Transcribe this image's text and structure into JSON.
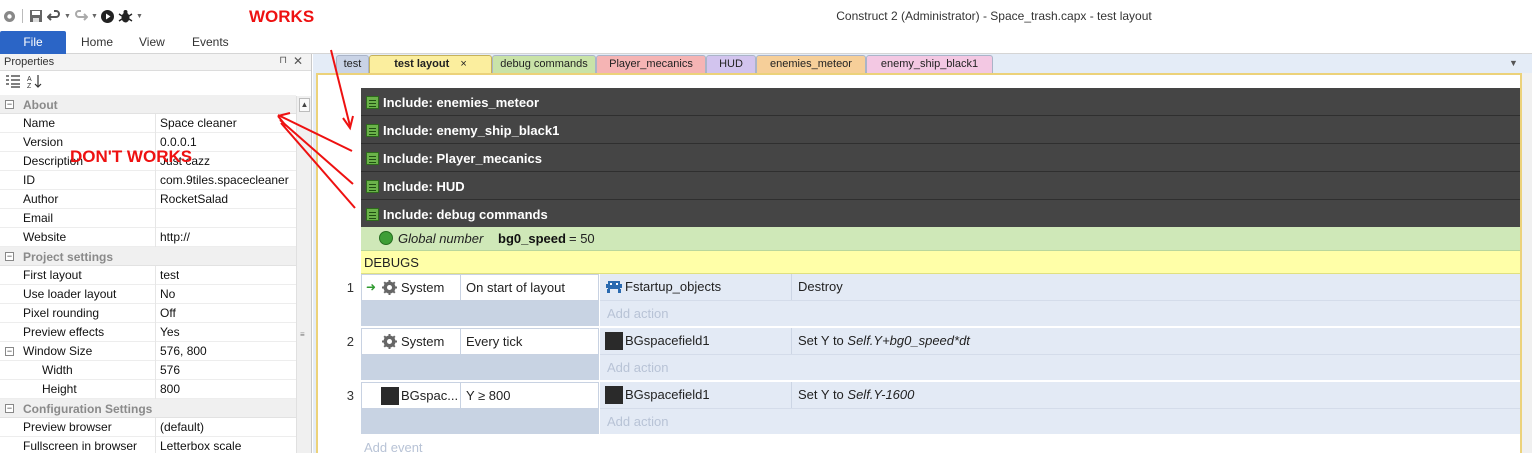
{
  "app": {
    "title": "Construct 2 (Administrator) - Space_trash.capx - test layout",
    "annotation_works": "WORKS",
    "annotation_dont_works": "DON'T WORKS"
  },
  "ribbon": {
    "tabs": [
      "File",
      "Home",
      "View",
      "Events"
    ]
  },
  "quick_access": [
    "gear-icon",
    "save-icon",
    "undo-icon",
    "redo-icon",
    "run-icon",
    "debug-icon"
  ],
  "properties": {
    "title": "Properties",
    "sections": [
      {
        "name": "About",
        "rows": [
          {
            "k": "Name",
            "v": "Space cleaner"
          },
          {
            "k": "Version",
            "v": "0.0.0.1"
          },
          {
            "k": "Description",
            "v": "Just cazz"
          },
          {
            "k": "ID",
            "v": "com.9tiles.spacecleaner"
          },
          {
            "k": "Author",
            "v": "RocketSalad"
          },
          {
            "k": "Email",
            "v": ""
          },
          {
            "k": "Website",
            "v": "http://"
          }
        ]
      },
      {
        "name": "Project settings",
        "rows": [
          {
            "k": "First layout",
            "v": "test"
          },
          {
            "k": "Use loader layout",
            "v": "No"
          },
          {
            "k": "Pixel rounding",
            "v": "Off"
          },
          {
            "k": "Preview effects",
            "v": "Yes"
          },
          {
            "k": "Window Size",
            "v": "576, 800"
          },
          {
            "k": "Width",
            "v": "576"
          },
          {
            "k": "Height",
            "v": "800"
          }
        ]
      },
      {
        "name": "Configuration Settings",
        "rows": [
          {
            "k": "Preview browser",
            "v": "(default)"
          },
          {
            "k": "Fullscreen in browser",
            "v": "Letterbox scale"
          }
        ]
      }
    ]
  },
  "editor_tabs": [
    {
      "label": "test",
      "color": "#c9d3e6"
    },
    {
      "label": "test layout",
      "color": "#fbee9e",
      "active": true,
      "close": "×"
    },
    {
      "label": "debug commands",
      "color": "#c9e3a8"
    },
    {
      "label": "Player_mecanics",
      "color": "#f5b4b4"
    },
    {
      "label": "HUD",
      "color": "#d2c4ee"
    },
    {
      "label": "enemies_meteor",
      "color": "#f6cf99"
    },
    {
      "label": "enemy_ship_black1",
      "color": "#f3c8e3"
    }
  ],
  "includes": [
    "Include: enemies_meteor",
    "Include: enemy_ship_black1",
    "Include: Player_mecanics",
    "Include: HUD",
    "Include: debug commands"
  ],
  "global_var": {
    "prefix": "Global number",
    "name": "bg0_speed",
    "value": "= 50"
  },
  "comment": "DEBUGS",
  "events": [
    {
      "num": "1",
      "object": "System",
      "condition": "On start of layout",
      "action_object": "Fstartup_objects",
      "action": "Destroy",
      "action_expr": "",
      "add_action": "Add action"
    },
    {
      "num": "2",
      "object": "System",
      "condition": "Every tick",
      "action_object": "BGspacefield1",
      "action": "Set Y to ",
      "action_expr": "Self.Y+bg0_speed*dt",
      "add_action": "Add action"
    },
    {
      "num": "3",
      "object": "BGspac...",
      "condition": "Y ≥ 800",
      "action_object": "BGspacefield1",
      "action": "Set Y to ",
      "action_expr": "Self.Y-1600",
      "add_action": "Add action"
    }
  ],
  "add_event": "Add event"
}
